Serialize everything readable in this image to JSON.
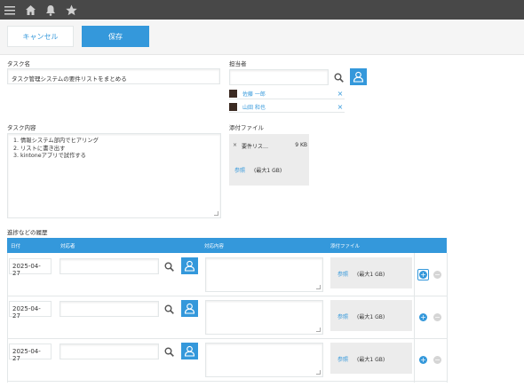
{
  "toolbar": {
    "cancel_label": "キャンセル",
    "save_label": "保存"
  },
  "task_name": {
    "label": "タスク名",
    "value": "タスク管理システムの要件リストをまとめる"
  },
  "assignee": {
    "label": "担当者",
    "input_value": "",
    "users": [
      {
        "name": "佐藤 一郎"
      },
      {
        "name": "山田 和也"
      }
    ]
  },
  "task_content": {
    "label": "タスク内容",
    "lines": [
      "1.  情報システム部内でヒアリング",
      "2.  リストに書き出す",
      "3.  kintoneアプリで試作する"
    ]
  },
  "attachments": {
    "label": "添付ファイル",
    "file_name": "要件リス…",
    "file_size": "9 KB",
    "browse_label": "参照",
    "max_label": "(最大1 GB)"
  },
  "history": {
    "label": "進捗などの履歴",
    "columns": [
      "日付",
      "対応者",
      "対応内容",
      "添付ファイル"
    ],
    "rows": [
      {
        "date": "2025-04-27",
        "browse_label": "参照",
        "max_label": "(最大1 GB)"
      },
      {
        "date": "2025-04-27",
        "browse_label": "参照",
        "max_label": "(最大1 GB)"
      },
      {
        "date": "2025-04-27",
        "browse_label": "参照",
        "max_label": "(最大1 GB)"
      }
    ]
  },
  "colors": {
    "accent": "#3498db",
    "topbar": "#484848"
  },
  "icons": [
    "menu-icon",
    "home-icon",
    "bell-icon",
    "star-icon",
    "search-icon",
    "user-select-icon",
    "close-icon",
    "plus-icon",
    "minus-icon"
  ]
}
